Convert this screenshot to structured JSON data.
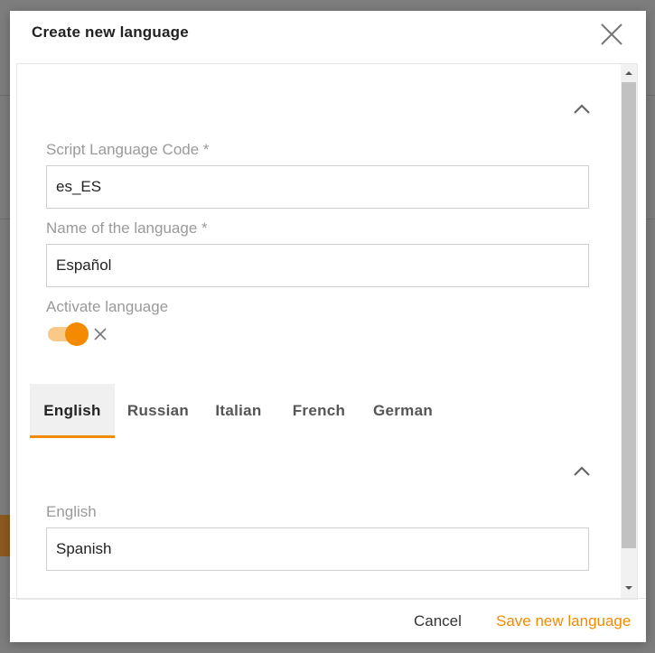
{
  "modal": {
    "title": "Create new language",
    "script_code": {
      "label": "Script Language Code *",
      "value": "es_ES"
    },
    "language_name": {
      "label": "Name of the language *",
      "value": "Español"
    },
    "activate": {
      "label": "Activate language",
      "on": true
    },
    "tabs": [
      {
        "label": "English",
        "active": true
      },
      {
        "label": "Russian",
        "active": false
      },
      {
        "label": "Italian",
        "active": false
      },
      {
        "label": "French",
        "active": false
      },
      {
        "label": "German",
        "active": false
      }
    ],
    "translation": {
      "label": "English",
      "value": "Spanish"
    },
    "footer": {
      "cancel_label": "Cancel",
      "save_label": "Save new language"
    }
  },
  "colors": {
    "accent": "#f48a00",
    "toggle_track": "#f9c98a",
    "label_gray": "#9a9a9a",
    "overlay": "#7d7d7d"
  },
  "icons": {
    "close": "close-icon",
    "collapse": "chevron-up-icon",
    "toggle_off": "x-icon"
  }
}
